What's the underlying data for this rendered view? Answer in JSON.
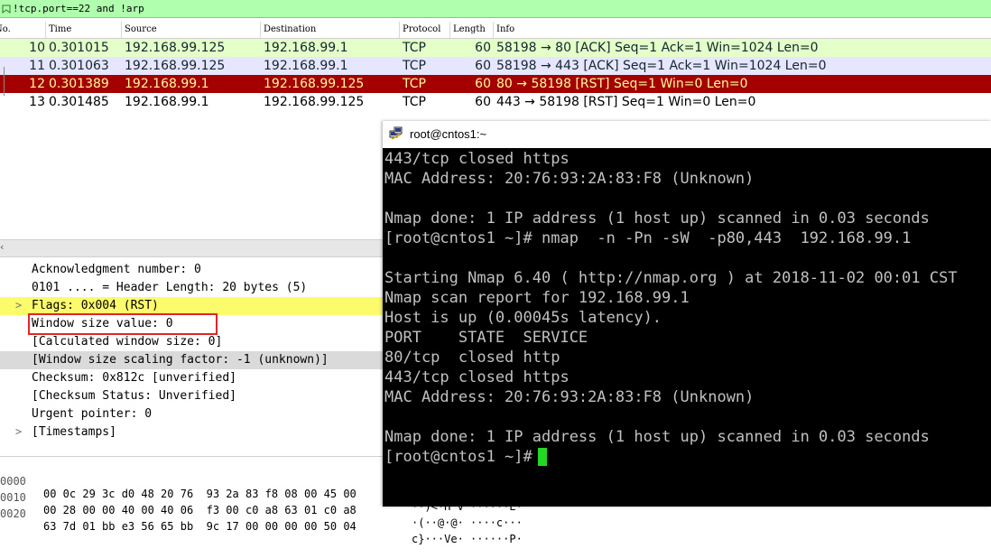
{
  "filter": {
    "text": "!tcp.port==22 and !arp"
  },
  "columns": [
    "No.",
    "Time",
    "Source",
    "Destination",
    "Protocol",
    "Length",
    "Info"
  ],
  "packets": [
    {
      "no": "10",
      "time": "0.301015",
      "src": "192.168.99.125",
      "dst": "192.168.99.1",
      "proto": "TCP",
      "len": "60",
      "info": "58198 → 80 [ACK] Seq=1 Ack=1 Win=1024 Len=0",
      "bg": "#e4ffc7",
      "fg": "#12272e"
    },
    {
      "no": "11",
      "time": "0.301063",
      "src": "192.168.99.125",
      "dst": "192.168.99.1",
      "proto": "TCP",
      "len": "60",
      "info": "58198 → 443 [ACK] Seq=1 Ack=1 Win=1024 Len=0",
      "bg": "#e7e6ff",
      "fg": "#12272e"
    },
    {
      "no": "12",
      "time": "0.301389",
      "src": "192.168.99.1",
      "dst": "192.168.99.125",
      "proto": "TCP",
      "len": "60",
      "info": "80 → 58198 [RST] Seq=1 Win=0 Len=0",
      "bg": "#a40000",
      "fg": "#fffc9c"
    },
    {
      "no": "13",
      "time": "0.301485",
      "src": "192.168.99.1",
      "dst": "192.168.99.125",
      "proto": "TCP",
      "len": "60",
      "info": "443 → 58198 [RST] Seq=1 Win=0 Len=0",
      "bg": "#ffffff",
      "fg": "#000000"
    }
  ],
  "details": [
    {
      "text": "Acknowledgment number: 0",
      "arrow": ""
    },
    {
      "text": "0101 .... = Header Length: 20 bytes (5)",
      "arrow": ""
    },
    {
      "text": "Flags: 0x004 (RST)",
      "arrow": ">"
    },
    {
      "text": "Window size value: 0",
      "arrow": ""
    },
    {
      "text": "[Calculated window size: 0]",
      "arrow": ""
    },
    {
      "text": "[Window size scaling factor: -1 (unknown)]",
      "arrow": ""
    },
    {
      "text": "Checksum: 0x812c [unverified]",
      "arrow": ""
    },
    {
      "text": "[Checksum Status: Unverified]",
      "arrow": ""
    },
    {
      "text": "Urgent pointer: 0",
      "arrow": ""
    },
    {
      "text": "[Timestamps]",
      "arrow": ">"
    }
  ],
  "hex": [
    {
      "off": "0000",
      "hex": "00 0c 29 3c d0 48 20 76  93 2a 83 f8 08 00 45 00",
      "asc": "··)<·H v ·*····E·"
    },
    {
      "off": "0010",
      "hex": "00 28 00 00 40 00 40 06  f3 00 c0 a8 63 01 c0 a8",
      "asc": "·(··@·@· ····c···"
    },
    {
      "off": "0020",
      "hex": "63 7d 01 bb e3 56 65 bb  9c 17 00 00 00 00 50 04",
      "asc": "c}···Ve· ······P·"
    }
  ],
  "terminal": {
    "title": "root@cntos1:~",
    "lines": [
      "443/tcp closed https",
      "MAC Address: 20:76:93:2A:83:F8 (Unknown)",
      "",
      "Nmap done: 1 IP address (1 host up) scanned in 0.03 seconds",
      "[root@cntos1 ~]# nmap  -n -Pn -sW  -p80,443  192.168.99.1",
      "",
      "Starting Nmap 6.40 ( http://nmap.org ) at 2018-11-02 00:01 CST",
      "Nmap scan report for 192.168.99.1",
      "Host is up (0.00045s latency).",
      "PORT    STATE  SERVICE",
      "80/tcp  closed http",
      "443/tcp closed https",
      "MAC Address: 20:76:93:2A:83:F8 (Unknown)",
      "",
      "Nmap done: 1 IP address (1 host up) scanned in 0.03 seconds",
      "[root@cntos1 ~]# "
    ],
    "bg": "#000000",
    "fg": "#c0c0c0",
    "cursor_color": "#23d823"
  }
}
